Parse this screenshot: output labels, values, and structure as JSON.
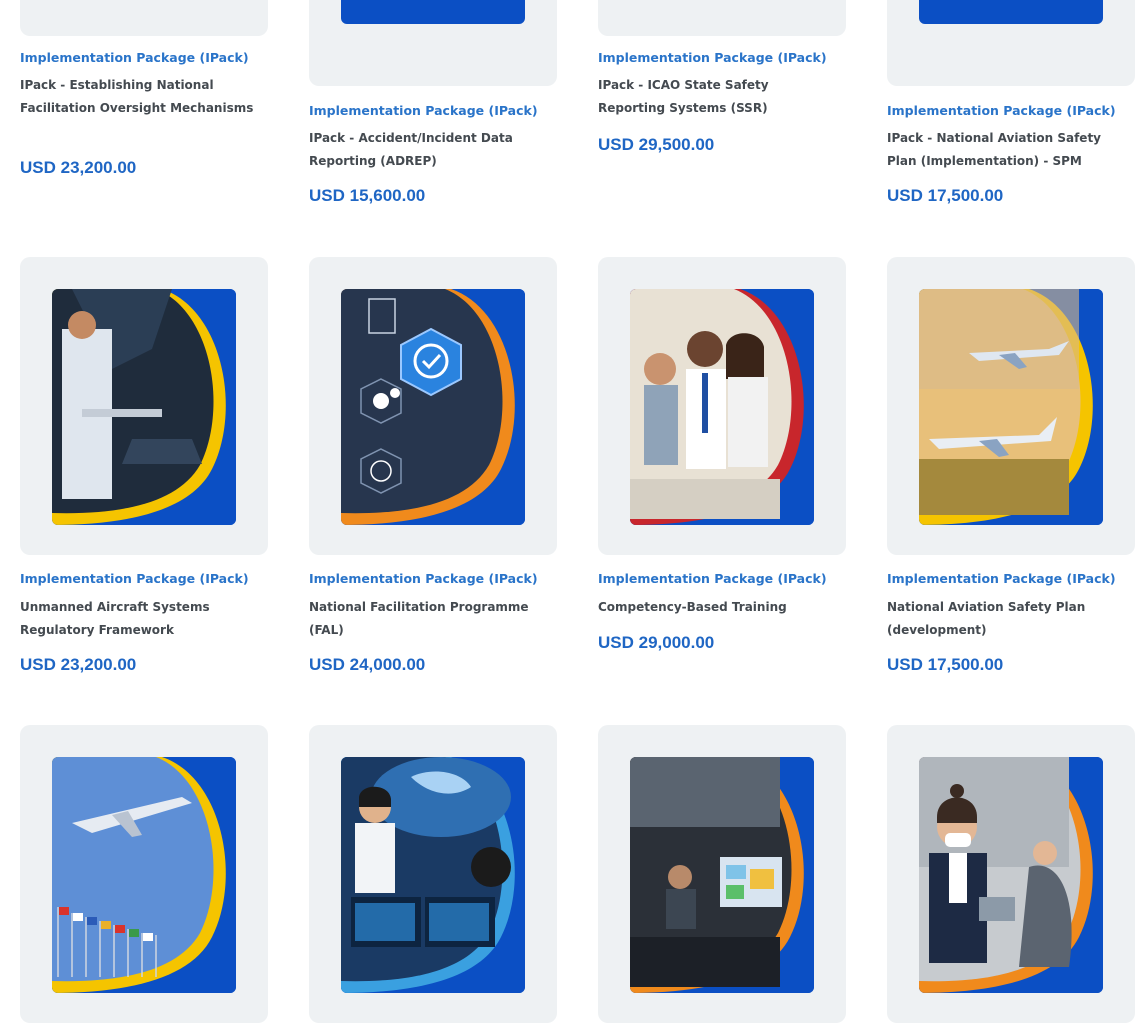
{
  "row1": [
    {
      "category": "Implementation Package (IPack)",
      "title": "IPack - Establishing National Facilitation Oversight Mechanisms",
      "price": "USD 23,200.00"
    },
    {
      "category": "Implementation Package (IPack)",
      "title": "IPack - Accident/Incident Data Reporting (ADREP)",
      "price": "USD 15,600.00"
    },
    {
      "category": "Implementation Package (IPack)",
      "title": "IPack - ICAO State Safety Reporting Systems (SSR)",
      "price": "USD 29,500.00"
    },
    {
      "category": "Implementation Package (IPack)",
      "title": "IPack - National Aviation Safety Plan (Implementation) - SPM",
      "price": "USD 17,500.00"
    }
  ],
  "row2": [
    {
      "category": "Implementation Package (IPack)",
      "title": "Unmanned Aircraft Systems Regulatory Framework",
      "price": "USD 23,200.00",
      "image": "scientist-drone-photo",
      "accent": "#f5c400"
    },
    {
      "category": "Implementation Package (IPack)",
      "title": "National Facilitation Programme (FAL)",
      "price": "USD 24,000.00",
      "image": "digital-hexagon-icons-photo",
      "accent": "#f08a1c"
    },
    {
      "category": "Implementation Package (IPack)",
      "title": "Competency-Based Training",
      "price": "USD 29,000.00",
      "image": "training-classroom-photo",
      "accent": "#c8262c"
    },
    {
      "category": "Implementation Package (IPack)",
      "title": "National Aviation Safety Plan (development)",
      "price": "USD 17,500.00",
      "image": "aircraft-airfield-photo",
      "accent": "#f5c400"
    }
  ],
  "row3": [
    {
      "image": "airplane-flags-photo",
      "accent": "#f5c400"
    },
    {
      "image": "network-operations-photo",
      "accent": "#3aa0e0"
    },
    {
      "image": "control-room-photo",
      "accent": "#f08a1c"
    },
    {
      "image": "masked-passenger-photo",
      "accent": "#f08a1c"
    }
  ]
}
